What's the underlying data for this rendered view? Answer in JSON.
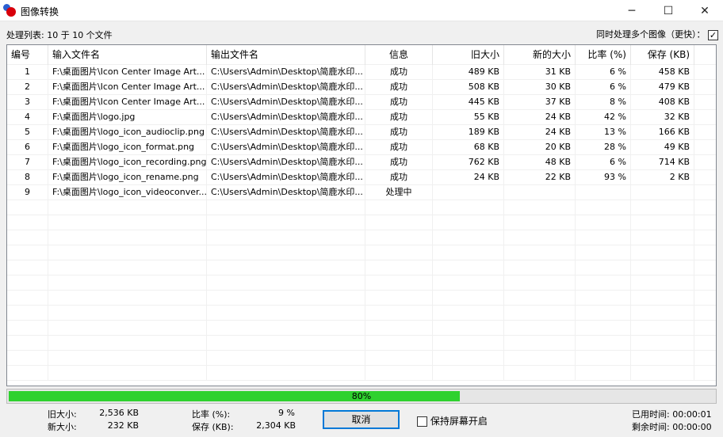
{
  "window": {
    "title": "图像转换",
    "minimize": "─",
    "maximize": "☐",
    "close": "✕"
  },
  "list_label": "处理列表: 10 于 10 个文件",
  "concurrent": {
    "label": "同时处理多个图像（更快）：",
    "checked": true
  },
  "columns": [
    "编号",
    "输入文件名",
    "输出文件名",
    "信息",
    "旧大小",
    "新的大小",
    "比率 (%)",
    "保存 (KB)"
  ],
  "rows": [
    [
      "1",
      "F:\\桌面图片\\Icon Center Image Art...",
      "C:\\Users\\Admin\\Desktop\\简鹿水印...",
      "成功",
      "489 KB",
      "31 KB",
      "6 %",
      "458 KB"
    ],
    [
      "2",
      "F:\\桌面图片\\Icon Center Image Art...",
      "C:\\Users\\Admin\\Desktop\\简鹿水印...",
      "成功",
      "508 KB",
      "30 KB",
      "6 %",
      "479 KB"
    ],
    [
      "3",
      "F:\\桌面图片\\Icon Center Image Art...",
      "C:\\Users\\Admin\\Desktop\\简鹿水印...",
      "成功",
      "445 KB",
      "37 KB",
      "8 %",
      "408 KB"
    ],
    [
      "4",
      "F:\\桌面图片\\logo.jpg",
      "C:\\Users\\Admin\\Desktop\\简鹿水印...",
      "成功",
      "55 KB",
      "24 KB",
      "42 %",
      "32 KB"
    ],
    [
      "5",
      "F:\\桌面图片\\logo_icon_audioclip.png",
      "C:\\Users\\Admin\\Desktop\\简鹿水印...",
      "成功",
      "189 KB",
      "24 KB",
      "13 %",
      "166 KB"
    ],
    [
      "6",
      "F:\\桌面图片\\logo_icon_format.png",
      "C:\\Users\\Admin\\Desktop\\简鹿水印...",
      "成功",
      "68 KB",
      "20 KB",
      "28 %",
      "49 KB"
    ],
    [
      "7",
      "F:\\桌面图片\\logo_icon_recording.png",
      "C:\\Users\\Admin\\Desktop\\简鹿水印...",
      "成功",
      "762 KB",
      "48 KB",
      "6 %",
      "714 KB"
    ],
    [
      "8",
      "F:\\桌面图片\\logo_icon_rename.png",
      "C:\\Users\\Admin\\Desktop\\简鹿水印...",
      "成功",
      "24 KB",
      "22 KB",
      "93 %",
      "2 KB"
    ],
    [
      "9",
      "F:\\桌面图片\\logo_icon_videoconver...",
      "C:\\Users\\Admin\\Desktop\\简鹿水印...",
      "处理中",
      "",
      "",
      "",
      ""
    ]
  ],
  "progress": {
    "percent": 80,
    "label": "80%"
  },
  "stats": {
    "old_label": "旧大小:",
    "old_value": "2,536 KB",
    "new_label": "新大小:",
    "new_value": "232 KB",
    "ratio_label": "比率 (%):",
    "ratio_value": "9 %",
    "saved_label": "保存 (KB):",
    "saved_value": "2,304 KB"
  },
  "cancel": "取消",
  "keep_screen": {
    "label": "保持屏幕开启",
    "checked": false
  },
  "time": {
    "elapsed_label": "已用时间:",
    "elapsed": "00:00:01",
    "remaining_label": "剩余时间:",
    "remaining": "00:00:00"
  },
  "colors": {
    "progress": "#2ed12e",
    "accent": "#0078d7"
  }
}
